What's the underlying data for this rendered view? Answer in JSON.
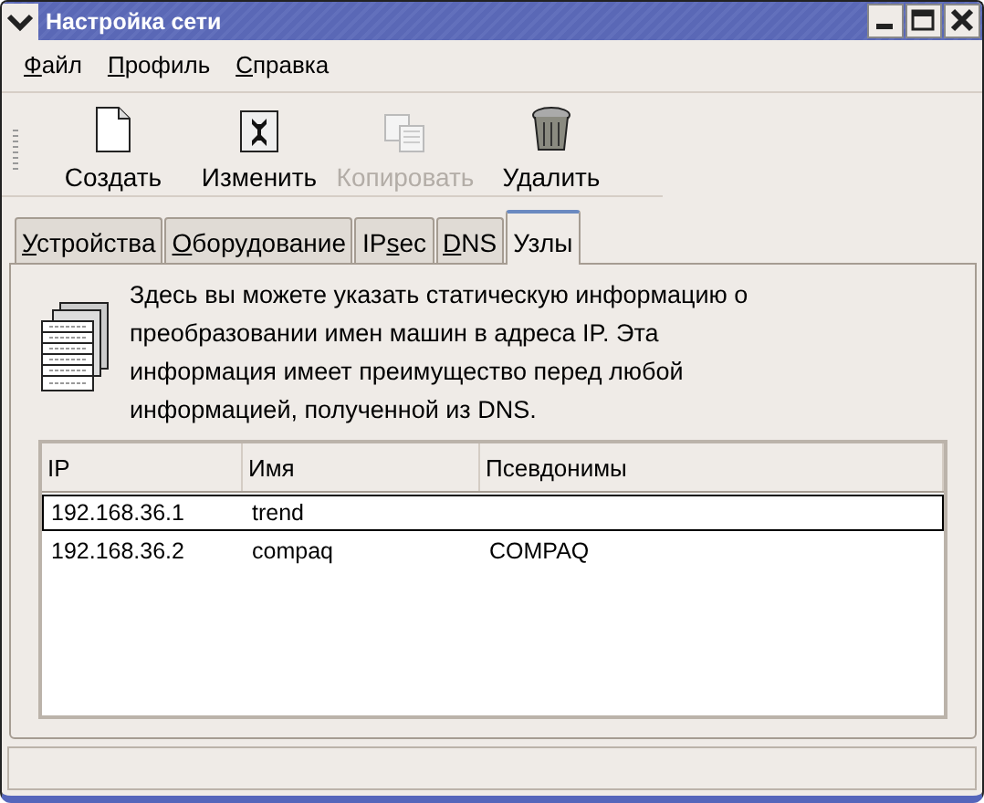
{
  "window": {
    "title": "Настройка сети"
  },
  "menu": [
    {
      "key": "Ф",
      "after": "айл"
    },
    {
      "key": "П",
      "after": "рофиль"
    },
    {
      "key": "С",
      "after": "правка"
    }
  ],
  "toolbar": [
    {
      "kind": "new",
      "label": "Создать",
      "disabled": false
    },
    {
      "kind": "edit",
      "label": "Изменить",
      "disabled": false
    },
    {
      "kind": "copy",
      "label": "Копировать",
      "disabled": true
    },
    {
      "kind": "delete",
      "label": "Удалить",
      "disabled": false
    }
  ],
  "tabs": [
    {
      "key": "У",
      "after": "стройства",
      "selected": false
    },
    {
      "key": "О",
      "after": "борудование",
      "selected": false
    },
    {
      "before": "IP",
      "key": "s",
      "after": "ec",
      "selected": false
    },
    {
      "key": "D",
      "after": "NS",
      "selected": false
    },
    {
      "before": "Узлы",
      "selected": true
    }
  ],
  "info": "Здесь вы можете указать статическую информацию о преобразовании имен машин в адреса IP. Эта информация имеет преимущество перед любой информацией, полученной из DNS.",
  "table": {
    "columns": [
      "IP",
      "Имя",
      "Псевдонимы"
    ],
    "rows": [
      {
        "cells": [
          "192.168.36.1",
          "trend",
          ""
        ],
        "selected": true
      },
      {
        "cells": [
          "192.168.36.2",
          "compaq",
          "COMPAQ"
        ],
        "selected": false
      }
    ]
  }
}
